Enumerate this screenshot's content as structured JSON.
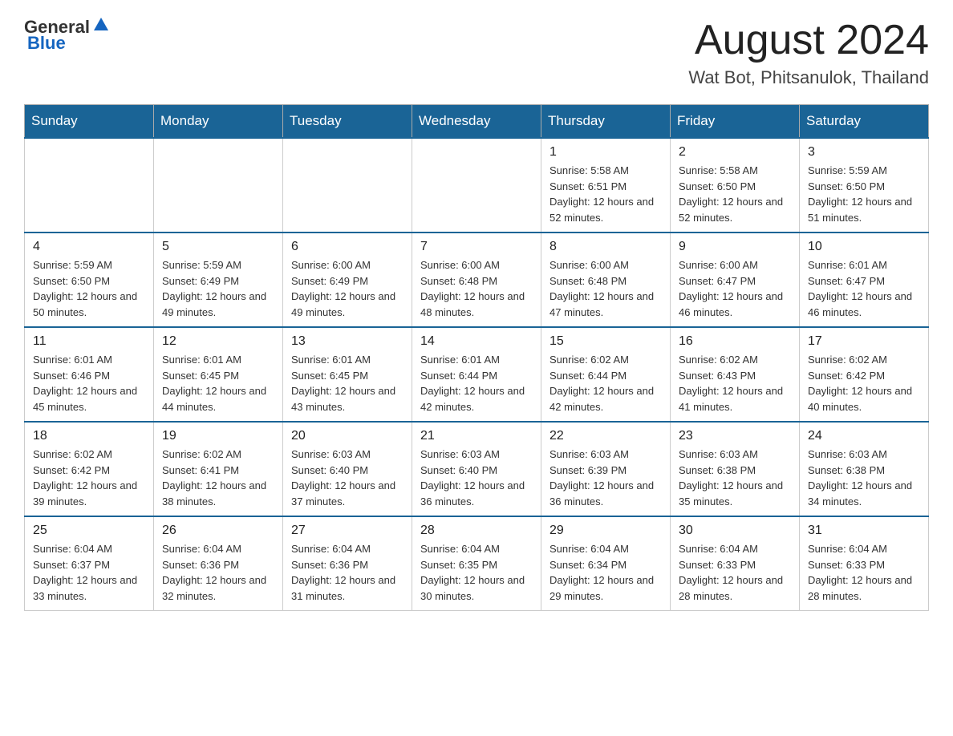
{
  "logo": {
    "general": "General",
    "blue": "Blue"
  },
  "header": {
    "month": "August 2024",
    "location": "Wat Bot, Phitsanulok, Thailand"
  },
  "days_of_week": [
    "Sunday",
    "Monday",
    "Tuesday",
    "Wednesday",
    "Thursday",
    "Friday",
    "Saturday"
  ],
  "weeks": [
    [
      {
        "day": "",
        "info": ""
      },
      {
        "day": "",
        "info": ""
      },
      {
        "day": "",
        "info": ""
      },
      {
        "day": "",
        "info": ""
      },
      {
        "day": "1",
        "info": "Sunrise: 5:58 AM\nSunset: 6:51 PM\nDaylight: 12 hours and 52 minutes."
      },
      {
        "day": "2",
        "info": "Sunrise: 5:58 AM\nSunset: 6:50 PM\nDaylight: 12 hours and 52 minutes."
      },
      {
        "day": "3",
        "info": "Sunrise: 5:59 AM\nSunset: 6:50 PM\nDaylight: 12 hours and 51 minutes."
      }
    ],
    [
      {
        "day": "4",
        "info": "Sunrise: 5:59 AM\nSunset: 6:50 PM\nDaylight: 12 hours and 50 minutes."
      },
      {
        "day": "5",
        "info": "Sunrise: 5:59 AM\nSunset: 6:49 PM\nDaylight: 12 hours and 49 minutes."
      },
      {
        "day": "6",
        "info": "Sunrise: 6:00 AM\nSunset: 6:49 PM\nDaylight: 12 hours and 49 minutes."
      },
      {
        "day": "7",
        "info": "Sunrise: 6:00 AM\nSunset: 6:48 PM\nDaylight: 12 hours and 48 minutes."
      },
      {
        "day": "8",
        "info": "Sunrise: 6:00 AM\nSunset: 6:48 PM\nDaylight: 12 hours and 47 minutes."
      },
      {
        "day": "9",
        "info": "Sunrise: 6:00 AM\nSunset: 6:47 PM\nDaylight: 12 hours and 46 minutes."
      },
      {
        "day": "10",
        "info": "Sunrise: 6:01 AM\nSunset: 6:47 PM\nDaylight: 12 hours and 46 minutes."
      }
    ],
    [
      {
        "day": "11",
        "info": "Sunrise: 6:01 AM\nSunset: 6:46 PM\nDaylight: 12 hours and 45 minutes."
      },
      {
        "day": "12",
        "info": "Sunrise: 6:01 AM\nSunset: 6:45 PM\nDaylight: 12 hours and 44 minutes."
      },
      {
        "day": "13",
        "info": "Sunrise: 6:01 AM\nSunset: 6:45 PM\nDaylight: 12 hours and 43 minutes."
      },
      {
        "day": "14",
        "info": "Sunrise: 6:01 AM\nSunset: 6:44 PM\nDaylight: 12 hours and 42 minutes."
      },
      {
        "day": "15",
        "info": "Sunrise: 6:02 AM\nSunset: 6:44 PM\nDaylight: 12 hours and 42 minutes."
      },
      {
        "day": "16",
        "info": "Sunrise: 6:02 AM\nSunset: 6:43 PM\nDaylight: 12 hours and 41 minutes."
      },
      {
        "day": "17",
        "info": "Sunrise: 6:02 AM\nSunset: 6:42 PM\nDaylight: 12 hours and 40 minutes."
      }
    ],
    [
      {
        "day": "18",
        "info": "Sunrise: 6:02 AM\nSunset: 6:42 PM\nDaylight: 12 hours and 39 minutes."
      },
      {
        "day": "19",
        "info": "Sunrise: 6:02 AM\nSunset: 6:41 PM\nDaylight: 12 hours and 38 minutes."
      },
      {
        "day": "20",
        "info": "Sunrise: 6:03 AM\nSunset: 6:40 PM\nDaylight: 12 hours and 37 minutes."
      },
      {
        "day": "21",
        "info": "Sunrise: 6:03 AM\nSunset: 6:40 PM\nDaylight: 12 hours and 36 minutes."
      },
      {
        "day": "22",
        "info": "Sunrise: 6:03 AM\nSunset: 6:39 PM\nDaylight: 12 hours and 36 minutes."
      },
      {
        "day": "23",
        "info": "Sunrise: 6:03 AM\nSunset: 6:38 PM\nDaylight: 12 hours and 35 minutes."
      },
      {
        "day": "24",
        "info": "Sunrise: 6:03 AM\nSunset: 6:38 PM\nDaylight: 12 hours and 34 minutes."
      }
    ],
    [
      {
        "day": "25",
        "info": "Sunrise: 6:04 AM\nSunset: 6:37 PM\nDaylight: 12 hours and 33 minutes."
      },
      {
        "day": "26",
        "info": "Sunrise: 6:04 AM\nSunset: 6:36 PM\nDaylight: 12 hours and 32 minutes."
      },
      {
        "day": "27",
        "info": "Sunrise: 6:04 AM\nSunset: 6:36 PM\nDaylight: 12 hours and 31 minutes."
      },
      {
        "day": "28",
        "info": "Sunrise: 6:04 AM\nSunset: 6:35 PM\nDaylight: 12 hours and 30 minutes."
      },
      {
        "day": "29",
        "info": "Sunrise: 6:04 AM\nSunset: 6:34 PM\nDaylight: 12 hours and 29 minutes."
      },
      {
        "day": "30",
        "info": "Sunrise: 6:04 AM\nSunset: 6:33 PM\nDaylight: 12 hours and 28 minutes."
      },
      {
        "day": "31",
        "info": "Sunrise: 6:04 AM\nSunset: 6:33 PM\nDaylight: 12 hours and 28 minutes."
      }
    ]
  ]
}
